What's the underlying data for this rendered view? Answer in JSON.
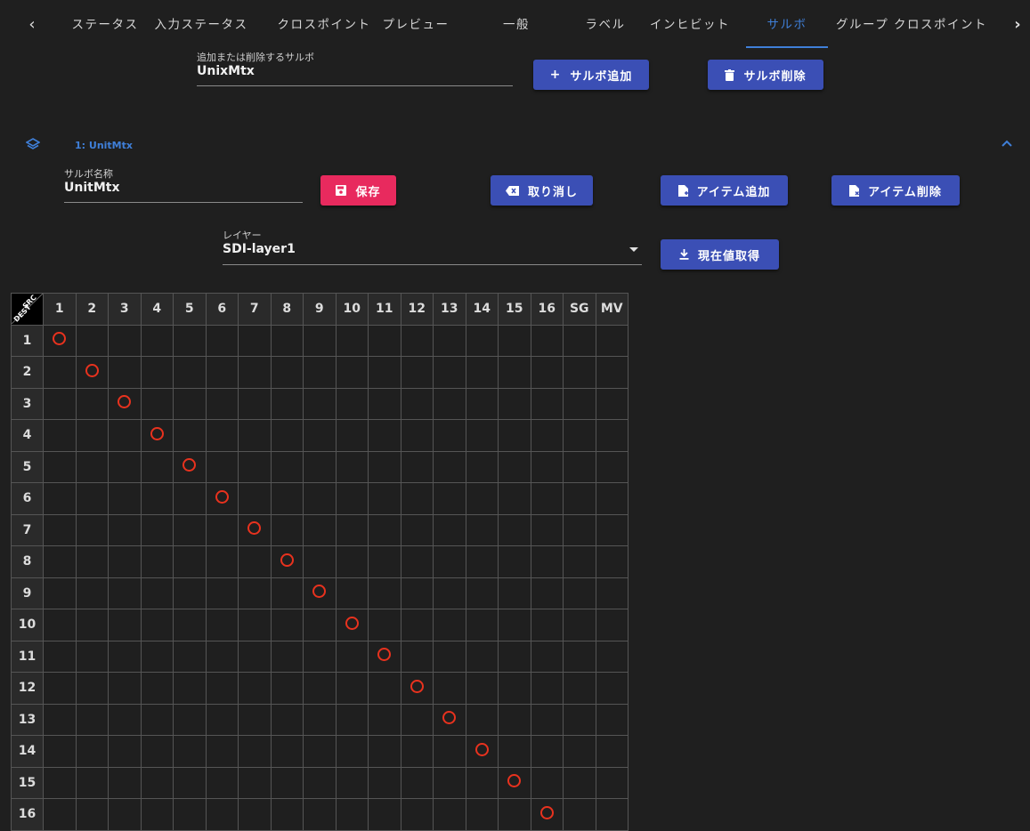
{
  "tabs": {
    "prev_icon": "chevron-left-icon",
    "next_icon": "chevron-right-icon",
    "items": [
      "ステータス",
      "入力ステータス",
      "クロスポイント",
      "プレビュー",
      "一般",
      "ラベル",
      "インヒビット",
      "サルボ",
      "グループ クロスポイント"
    ],
    "active_index": 7
  },
  "salvo_add_delete": {
    "label": "追加または削除するサルボ",
    "value": "UnixMtx",
    "add_button": "サルボ追加",
    "delete_button": "サルボ削除"
  },
  "panel": {
    "title": "1: UnitMtx",
    "name_label": "サルボ名称",
    "name_value": "UnitMtx",
    "save_button": "保存",
    "cancel_button": "取り消し",
    "add_item_button": "アイテム追加",
    "delete_item_button": "アイテム削除",
    "layer_label": "レイヤー",
    "layer_value": "SDI-layer1",
    "get_current_button": "現在値取得"
  },
  "colors": {
    "accent": "#3f7fd8",
    "primary_button": "#3b4fb5",
    "save_button": "#e82a5e",
    "crosspoint_marker": "#e8321e"
  },
  "matrix": {
    "corner_src": "SRC",
    "corner_dest": "DEST",
    "columns": [
      "1",
      "2",
      "3",
      "4",
      "5",
      "6",
      "7",
      "8",
      "9",
      "10",
      "11",
      "12",
      "13",
      "14",
      "15",
      "16",
      "SG",
      "MV"
    ],
    "rows": [
      "1",
      "2",
      "3",
      "4",
      "5",
      "6",
      "7",
      "8",
      "9",
      "10",
      "11",
      "12",
      "13",
      "14",
      "15",
      "16"
    ],
    "crosspoints": [
      {
        "dest": "1",
        "src": "1"
      },
      {
        "dest": "2",
        "src": "2"
      },
      {
        "dest": "3",
        "src": "3"
      },
      {
        "dest": "4",
        "src": "4"
      },
      {
        "dest": "5",
        "src": "5"
      },
      {
        "dest": "6",
        "src": "6"
      },
      {
        "dest": "7",
        "src": "7"
      },
      {
        "dest": "8",
        "src": "8"
      },
      {
        "dest": "9",
        "src": "9"
      },
      {
        "dest": "10",
        "src": "10"
      },
      {
        "dest": "11",
        "src": "11"
      },
      {
        "dest": "12",
        "src": "12"
      },
      {
        "dest": "13",
        "src": "13"
      },
      {
        "dest": "14",
        "src": "14"
      },
      {
        "dest": "15",
        "src": "15"
      },
      {
        "dest": "16",
        "src": "16"
      }
    ]
  }
}
